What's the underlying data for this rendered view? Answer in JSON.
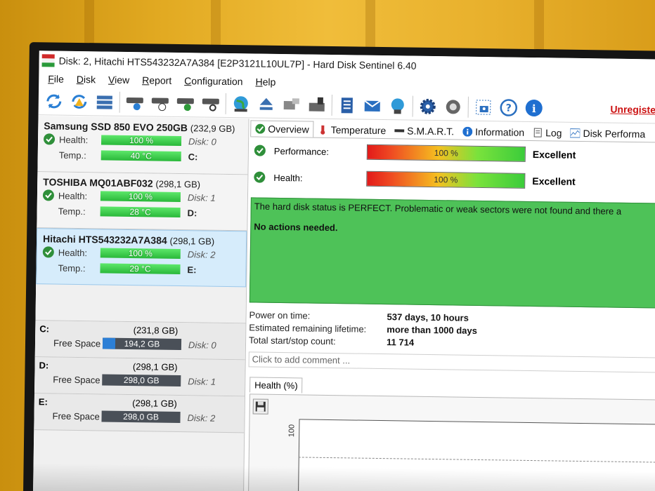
{
  "window": {
    "title": "Disk: 2, Hitachi HTS543232A7A384 [E2P3121L10UL7P]  -  Hard Disk Sentinel 6.40"
  },
  "menu": [
    "File",
    "Disk",
    "View",
    "Report",
    "Configuration",
    "Help"
  ],
  "toolbar": {
    "unregistered": "Unregistered"
  },
  "disks": [
    {
      "name": "Samsung SSD 850 EVO 250GB",
      "size": "(232,9 GB)",
      "health_label": "Health:",
      "health": "100 %",
      "disk": "Disk: 0",
      "temp_label": "Temp.:",
      "temp": "40 °C",
      "drive": "C:"
    },
    {
      "name": "TOSHIBA MQ01ABF032",
      "size": "(298,1 GB)",
      "health_label": "Health:",
      "health": "100 %",
      "disk": "Disk: 1",
      "temp_label": "Temp.:",
      "temp": "28 °C",
      "drive": "D:"
    },
    {
      "name": "Hitachi HTS543232A7A384",
      "size": "(298,1 GB)",
      "health_label": "Health:",
      "health": "100 %",
      "disk": "Disk: 2",
      "temp_label": "Temp.:",
      "temp": "29 °C",
      "drive": "E:"
    }
  ],
  "volumes": [
    {
      "letter": "C:",
      "size": "(231,8 GB)",
      "label": "Free Space",
      "free": "194,2 GB",
      "disk": "Disk: 0"
    },
    {
      "letter": "D:",
      "size": "(298,1 GB)",
      "label": "Free Space",
      "free": "298,0 GB",
      "disk": "Disk: 1"
    },
    {
      "letter": "E:",
      "size": "(298,1 GB)",
      "label": "Free Space",
      "free": "298,0 GB",
      "disk": "Disk: 2"
    }
  ],
  "tabs": [
    "Overview",
    "Temperature",
    "S.M.A.R.T.",
    "Information",
    "Log",
    "Disk Performa"
  ],
  "overview": {
    "performance_label": "Performance:",
    "performance_value": "100 %",
    "performance_word": "Excellent",
    "health_label": "Health:",
    "health_value": "100 %",
    "health_word": "Excellent",
    "status_line1": "The hard disk status is PERFECT. Problematic or weak sectors were not found and there a",
    "status_line2": "No actions needed.",
    "power_on_label": "Power on time:",
    "power_on_value": "537 days, 10 hours",
    "lifetime_label": "Estimated remaining lifetime:",
    "lifetime_value": "more than 1000 days",
    "startstop_label": "Total start/stop count:",
    "startstop_value": "11 714",
    "comment_placeholder": "Click to add comment ...",
    "health_tab": "Health (%)",
    "chart_tick": "100"
  },
  "colors": {
    "health_green": "#2ab83a",
    "unregistered": "#cc1111",
    "status_box": "#4ec258",
    "selected_row": "#d6ecfb"
  },
  "icons": [
    "refresh-icon",
    "refresh-warning-icon",
    "disk-list-icon",
    "disk-health-icon",
    "disk-schedule-icon",
    "disk-check-icon",
    "disk-search-icon",
    "globe-icon",
    "eject-icon",
    "drive-tools-icon",
    "drive-info-icon",
    "notes-icon",
    "mail-icon",
    "network-icon",
    "gear-icon",
    "sound-icon",
    "screenshot-icon",
    "help-icon",
    "info-icon"
  ]
}
